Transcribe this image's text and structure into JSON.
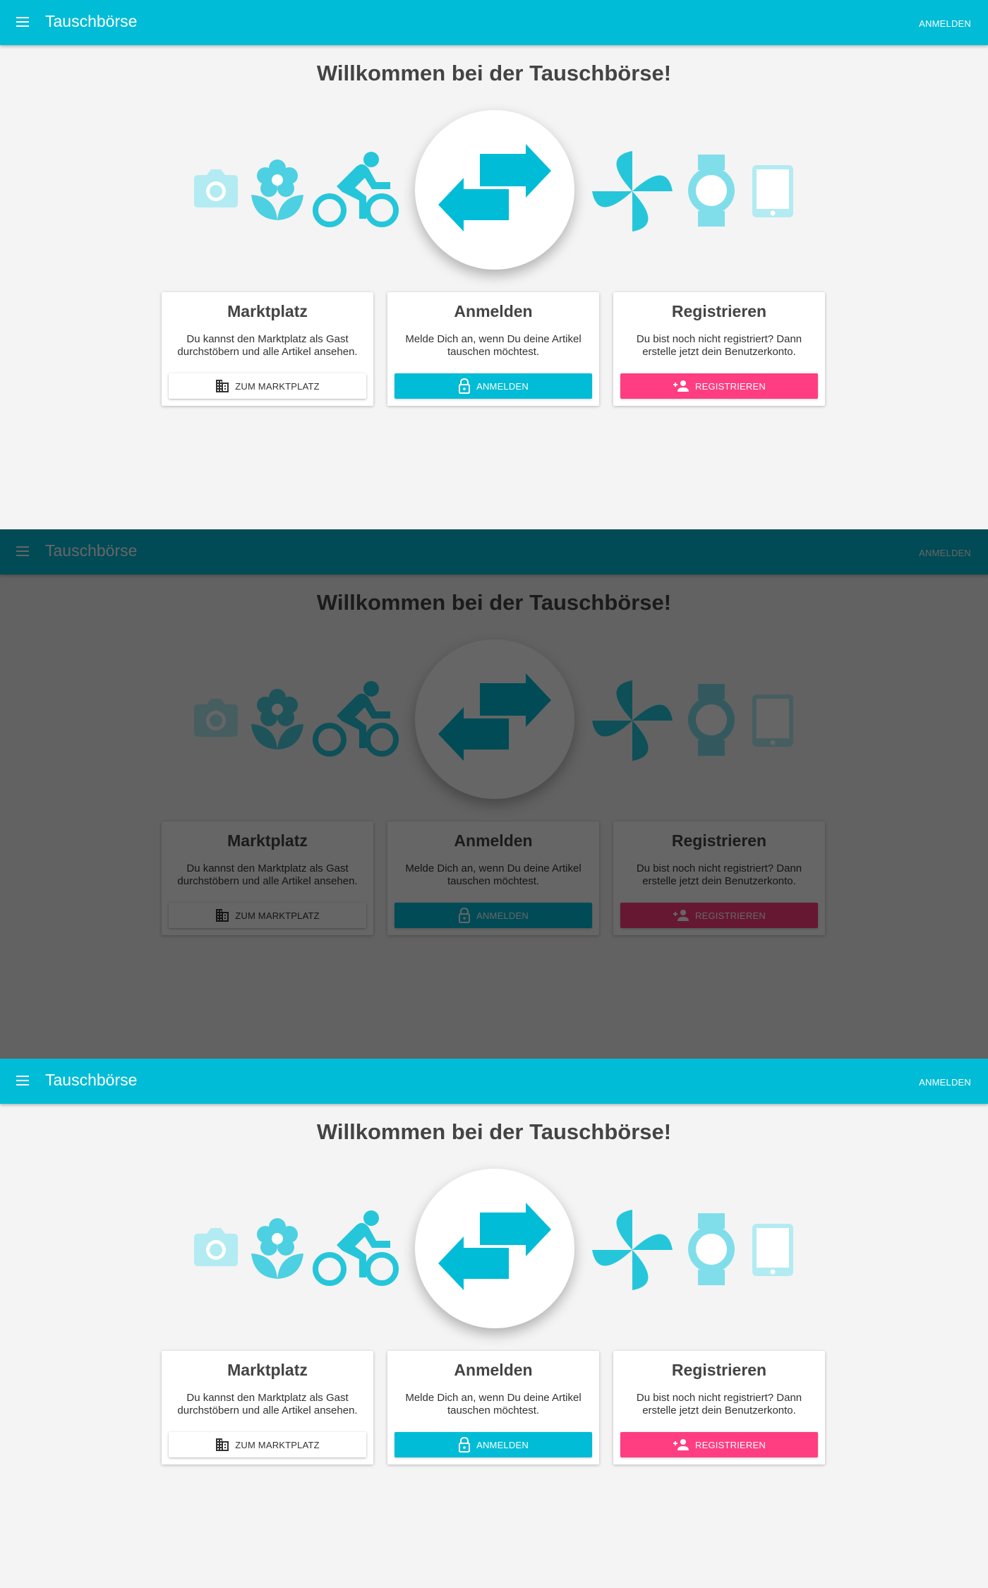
{
  "app": {
    "title": "Tauschbörse",
    "login_link": "ANMELDEN"
  },
  "main": {
    "welcome": "Willkommen bei der Tauschbörse!"
  },
  "cards": [
    {
      "title": "Marktplatz",
      "text": "Du kannst den Marktplatz als Gast durchstöbern und alle Artikel ansehen.",
      "button": "ZUM MARKTPLATZ",
      "icon": "building-icon"
    },
    {
      "title": "Anmelden",
      "text": "Melde Dich an, wenn Du deine Artikel tauschen möchtest.",
      "button": "ANMELDEN",
      "icon": "lock-icon"
    },
    {
      "title": "Registrieren",
      "text": "Du bist noch nicht registriert? Dann erstelle jetzt dein Benutzerkonto.",
      "button": "REGISTRIEREN",
      "icon": "person-add-icon"
    }
  ],
  "icons": [
    "camera-icon",
    "flower-icon",
    "bicycle-icon",
    "swap-arrows-icon",
    "pinwheel-icon",
    "watch-icon",
    "tablet-icon"
  ],
  "colors": {
    "primary": "#00bcd6",
    "accent": "#ff3d80",
    "background": "#f4f4f4",
    "overlay": "rgba(0,0,0,0.6)"
  }
}
